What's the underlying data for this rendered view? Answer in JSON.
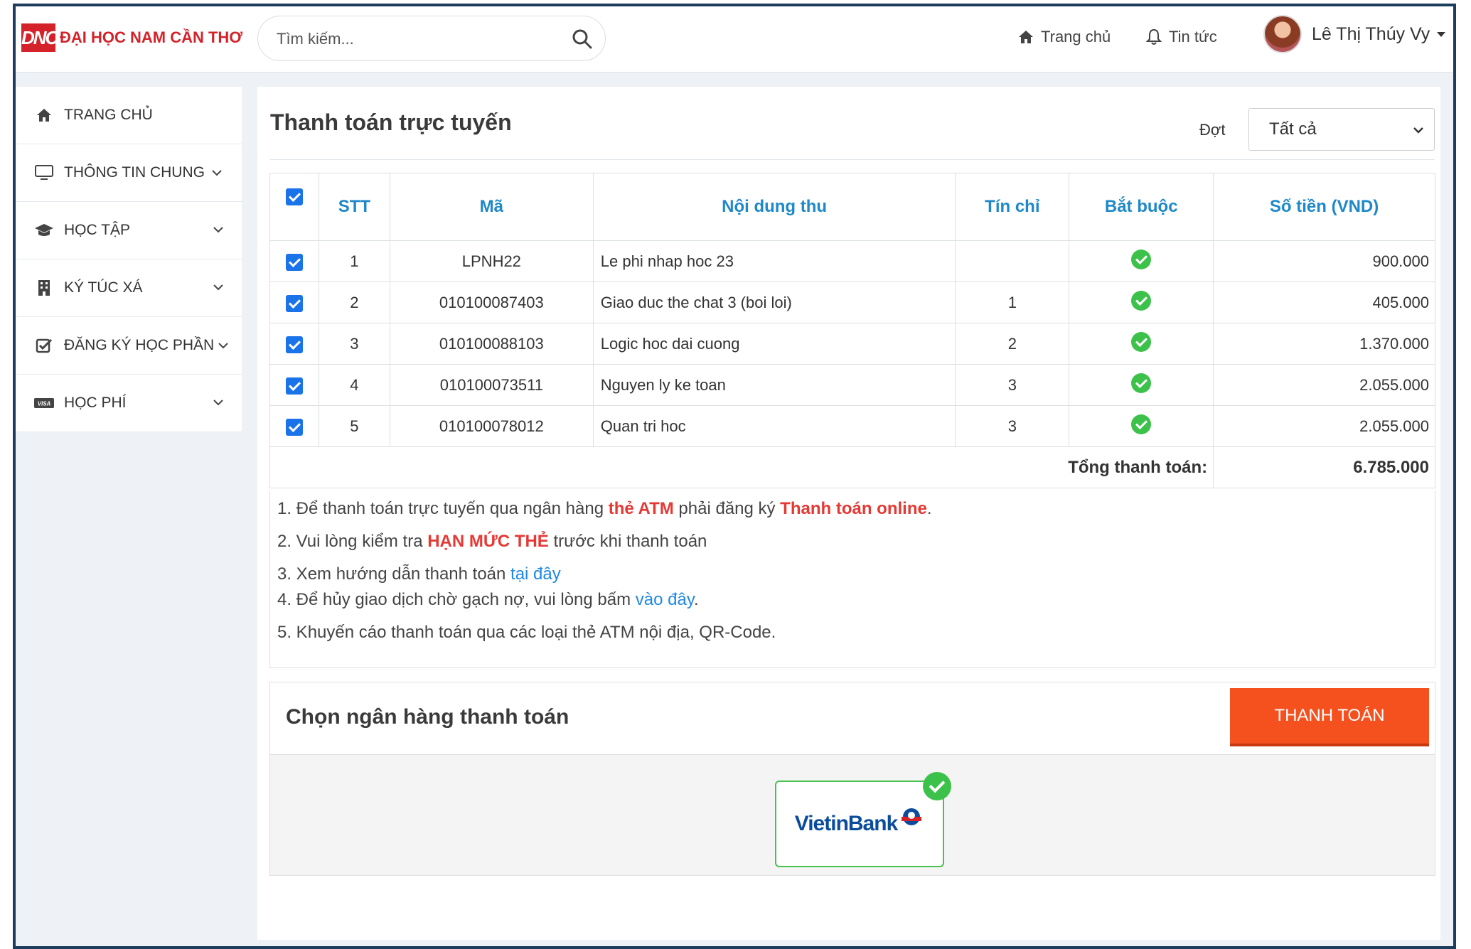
{
  "header": {
    "logo_mark": "DNC",
    "logo_text": "ĐẠI HỌC NAM CẦN THƠ",
    "search_placeholder": "Tìm kiếm...",
    "nav_home": "Trang chủ",
    "nav_news": "Tin tức",
    "user_name": "Lê Thị Thúy Vy"
  },
  "sidebar": {
    "items": [
      {
        "label": "TRANG CHỦ",
        "icon": "home-icon"
      },
      {
        "label": "THÔNG TIN CHUNG",
        "icon": "monitor-icon"
      },
      {
        "label": "HỌC TẬP",
        "icon": "graduation-cap-icon"
      },
      {
        "label": "KÝ TÚC XÁ",
        "icon": "building-icon"
      },
      {
        "label": "ĐĂNG KÝ HỌC PHẦN",
        "icon": "checkbox-icon"
      },
      {
        "label": "HỌC PHÍ",
        "icon": "visa-card-icon"
      }
    ]
  },
  "main": {
    "title": "Thanh toán trực tuyến",
    "filter_label": "Đợt",
    "filter_value": "Tất cả",
    "table": {
      "headers": [
        "STT",
        "Mã",
        "Nội dung thu",
        "Tín chỉ",
        "Bắt buộc",
        "Số tiền (VND)"
      ],
      "rows": [
        {
          "stt": "1",
          "code": "LPNH22",
          "content": "Le phi nhap hoc 23",
          "credits": "",
          "required": true,
          "amount": "900.000"
        },
        {
          "stt": "2",
          "code": "010100087403",
          "content": "Giao duc the chat 3 (boi loi)",
          "credits": "1",
          "required": true,
          "amount": "405.000"
        },
        {
          "stt": "3",
          "code": "010100088103",
          "content": "Logic hoc dai cuong",
          "credits": "2",
          "required": true,
          "amount": "1.370.000"
        },
        {
          "stt": "4",
          "code": "010100073511",
          "content": "Nguyen ly ke toan",
          "credits": "3",
          "required": true,
          "amount": "2.055.000"
        },
        {
          "stt": "5",
          "code": "010100078012",
          "content": "Quan tri hoc",
          "credits": "3",
          "required": true,
          "amount": "2.055.000"
        }
      ],
      "total_label": "Tổng thanh toán:",
      "total_value": "6.785.000"
    },
    "notes": {
      "n1_pre": "1. Để thanh toán trực tuyến qua ngân hàng ",
      "n1_bold1": "thẻ ATM",
      "n1_mid": " phải đăng ký ",
      "n1_bold2": "Thanh toán online",
      "n1_post": ".",
      "n2_pre": "2. Vui lòng kiểm tra ",
      "n2_bold": "HẠN MỨC THẺ",
      "n2_post": " trước khi thanh toán",
      "n3_pre": "3. Xem hướng dẫn thanh toán ",
      "n3_link": "tại đây",
      "n4_pre": "4. Để hủy giao dịch chờ gạch nợ, vui lòng bấm ",
      "n4_link": "vào đây",
      "n4_post": ".",
      "n5": "5. Khuyến cáo thanh toán qua các loại thẻ ATM nội địa, QR-Code."
    },
    "bank": {
      "title": "Chọn ngân hàng thanh toán",
      "pay_button": "THANH TOÁN",
      "bank_name": "VietinBank"
    }
  },
  "colors": {
    "accent_blue": "#1e88c8",
    "checkbox": "#1a73e8",
    "ok_green": "#3cc24a",
    "pay_button": "#f4511e",
    "warning_red": "#e53935",
    "logo_red": "#d4222a"
  }
}
